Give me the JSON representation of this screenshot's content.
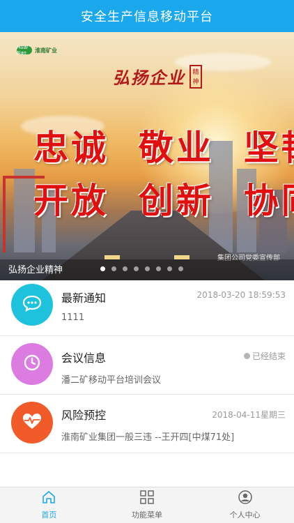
{
  "header": {
    "title": "安全生产信息移动平台"
  },
  "banner": {
    "logo_mark": "Huai Nan",
    "logo_text": "淮南矿业",
    "calligraphy": "弘扬企业",
    "seal_text": "精神",
    "slogan_row1": "忠诚  敬业  坚韧",
    "slogan_row2": "开放  创新  协同",
    "caption": "弘扬企业精神",
    "sign_text": "集团公司党委宣传部",
    "dot_count": 8,
    "active_dot": 1
  },
  "list": {
    "items": [
      {
        "title": "最新通知",
        "meta": "2018-03-20 18:59:53",
        "subtitle": "1111",
        "icon": "chat-bubble-icon",
        "icon_color": "#1ec2dc"
      },
      {
        "title": "会议信息",
        "meta": "已经结束",
        "subtitle": "潘二矿移动平台培训会议",
        "icon": "clock-icon",
        "icon_color": "#dc7ce0"
      },
      {
        "title": "风险预控",
        "meta": "2018-04-11星期三",
        "subtitle": "淮南矿业集团一般三违 --王开四[中煤71处]",
        "icon": "heart-pulse-icon",
        "icon_color": "#f15b2a"
      }
    ]
  },
  "tabbar": {
    "tabs": [
      {
        "label": "首页",
        "icon": "home-icon",
        "active": true
      },
      {
        "label": "功能菜单",
        "icon": "grid-icon",
        "active": false
      },
      {
        "label": "个人中心",
        "icon": "user-icon",
        "active": false
      }
    ]
  },
  "colors": {
    "header": "#1aa7ec",
    "accent": "#1aa7ec",
    "slogan": "#e01010"
  }
}
